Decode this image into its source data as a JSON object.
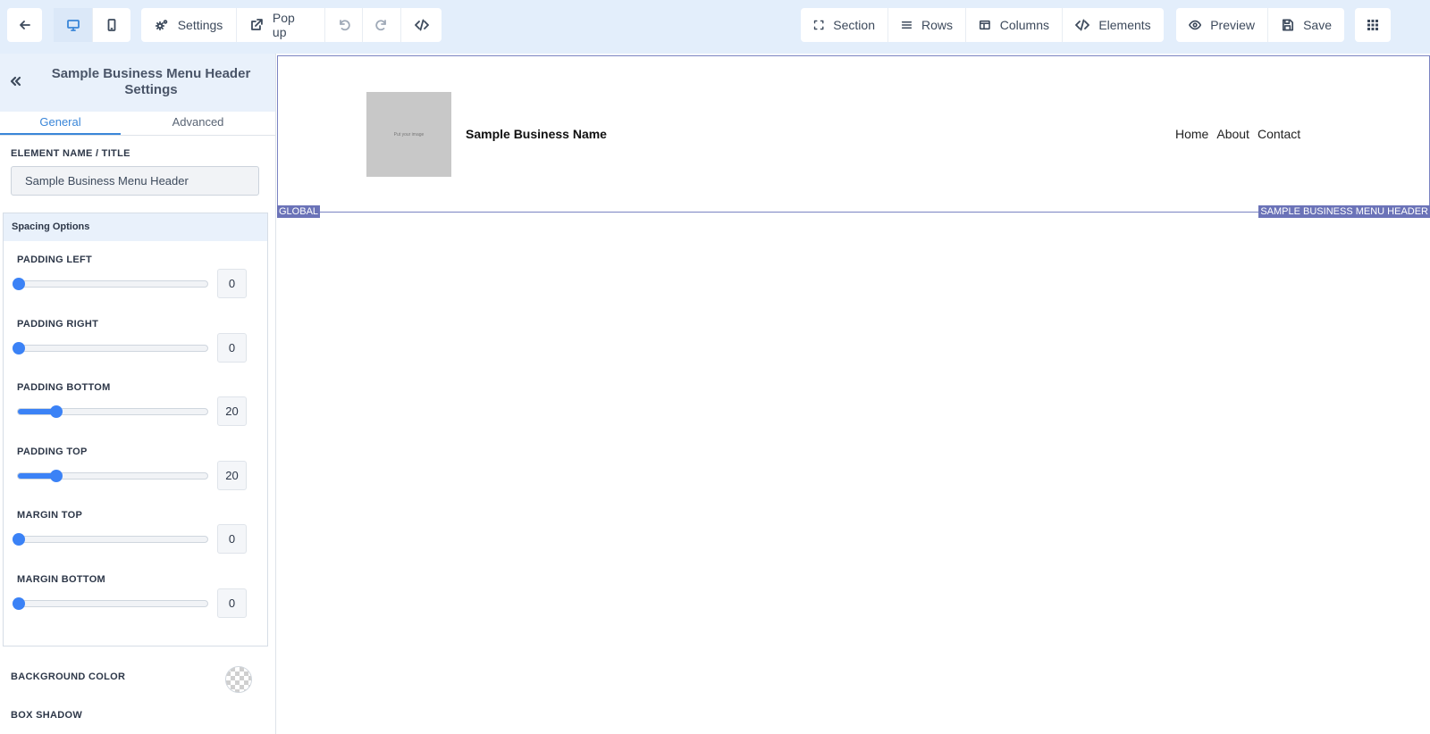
{
  "toolbar": {
    "settings_label": "Settings",
    "popup_label": "Pop up",
    "section_label": "Section",
    "rows_label": "Rows",
    "columns_label": "Columns",
    "elements_label": "Elements",
    "preview_label": "Preview",
    "save_label": "Save",
    "active_device": "desktop"
  },
  "panel": {
    "title": "Sample Business Menu Header Settings",
    "tabs": [
      "General",
      "Advanced"
    ],
    "active_tab": "General",
    "element_name_label": "ELEMENT NAME / TITLE",
    "element_name_value": "Sample Business Menu Header",
    "spacing_title": "Spacing Options",
    "spacing": [
      {
        "label": "PADDING LEFT",
        "value": "0",
        "level": 0
      },
      {
        "label": "PADDING RIGHT",
        "value": "0",
        "level": 0
      },
      {
        "label": "PADDING BOTTOM",
        "value": "20",
        "level": 0.2
      },
      {
        "label": "PADDING TOP",
        "value": "20",
        "level": 0.2
      },
      {
        "label": "MARGIN TOP",
        "value": "0",
        "level": 0
      },
      {
        "label": "MARGIN BOTTOM",
        "value": "0",
        "level": 0
      }
    ],
    "background_color_label": "BACKGROUND COLOR",
    "box_shadow_label": "BOX SHADOW"
  },
  "canvas": {
    "logo_placeholder": "Put your image",
    "business_name": "Sample Business Name",
    "nav_items": [
      "Home",
      "About",
      "Contact"
    ],
    "global_tag": "GLOBAL",
    "element_tag": "SAMPLE BUSINESS MENU HEADER"
  },
  "colors": {
    "accent": "#3b82f6",
    "toolbar_bg": "#e3eefb",
    "outline": "#7a83c2",
    "tag_bg": "#6b73b8"
  }
}
